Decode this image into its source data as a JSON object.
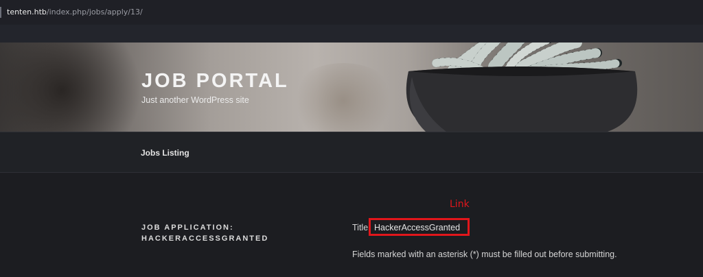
{
  "browser": {
    "url_host": "tenten.htb",
    "url_path": "/index.php/jobs/apply/13/"
  },
  "site": {
    "title": "JOB PORTAL",
    "tagline": "Just another WordPress site"
  },
  "nav": {
    "items": [
      {
        "label": "Jobs Listing"
      }
    ]
  },
  "annotation": {
    "label": "Link",
    "color": "#e2161b"
  },
  "job_application": {
    "heading_line1": "JOB APPLICATION:",
    "heading_line2": "HACKERACCESSGRANTED",
    "title_label": "Title:",
    "title_value": "HackerAccessGranted",
    "required_hint": "Fields marked with an asterisk (*) must be filled out before submitting."
  },
  "colors": {
    "page_background": "#1c1d21",
    "highlight": "#e2161b"
  }
}
